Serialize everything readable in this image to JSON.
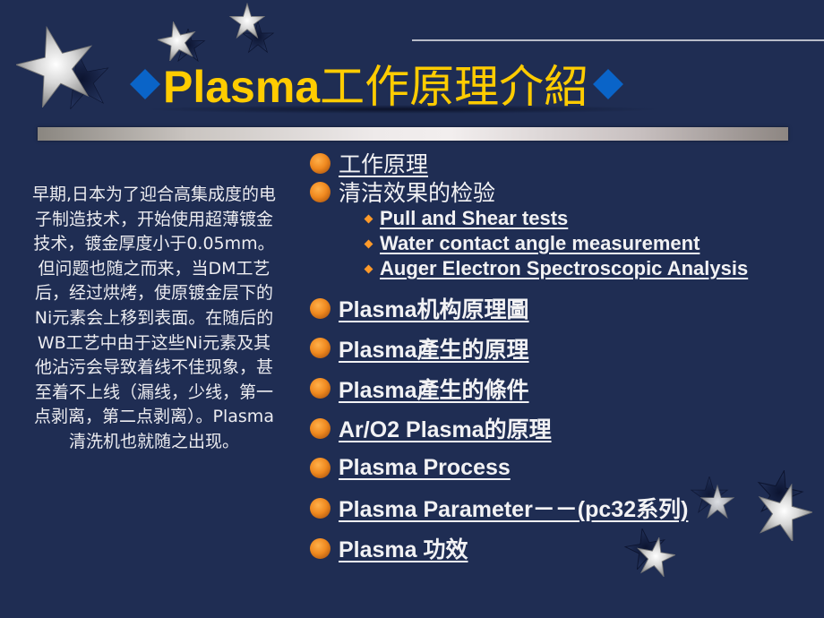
{
  "slide": {
    "title": {
      "latin": "Plasma",
      "cjk": "工作原理介紹",
      "left_icon": "blue-diamond-icon",
      "right_icon": "blue-diamond-icon",
      "color": "#ffcc00"
    },
    "intro_text": "早期,日本为了迎合高集成度的电子制造技术，开始使用超薄镀金技术，镀金厚度小于0.05mm。但问题也随之而来，当DM工艺后，经过烘烤，使原镀金层下的Ni元素会上移到表面。在随后的WB工艺中由于这些Ni元素及其他沾污会导致着线不佳现象，甚至着不上线（漏线，少线，第一点剥离，第二点剥离）。Plasma清洗机也就随之出现。",
    "menu": {
      "items": [
        {
          "label": "工作原理",
          "icon": "orange-ball-bullet-icon",
          "link": true
        },
        {
          "label": "清洁效果的检验",
          "icon": "orange-ball-bullet-icon",
          "link": false,
          "subitems": [
            {
              "label": "Pull and Shear tests",
              "icon": "orange-diamond-bullet-icon"
            },
            {
              "label": "Water contact angle measurement",
              "icon": "orange-diamond-bullet-icon"
            },
            {
              "label": "Auger Electron Spectroscopic Analysis",
              "icon": "orange-diamond-bullet-icon"
            }
          ]
        },
        {
          "label": "Plasma机构原理圖",
          "icon": "orange-ball-bullet-icon",
          "link": true
        },
        {
          "label": "Plasma產生的原理",
          "icon": "orange-ball-bullet-icon",
          "link": true
        },
        {
          "label": "Plasma產生的條件",
          "icon": "orange-ball-bullet-icon",
          "link": true
        },
        {
          "label": "Ar/O2 Plasma的原理",
          "icon": "orange-ball-bullet-icon",
          "link": true
        },
        {
          "label": "Plasma Process",
          "icon": "orange-ball-bullet-icon",
          "link": true
        },
        {
          "label": "Plasma Parameter－－(pc32系列)",
          "icon": "orange-ball-bullet-icon",
          "link": true
        },
        {
          "label": "Plasma 功效",
          "icon": "orange-ball-bullet-icon",
          "link": true
        }
      ]
    },
    "colors": {
      "background": "#1f2d53",
      "accent_diamond": "#0a64c8",
      "bullet": "#f08a20",
      "text": "#f2f2f4"
    },
    "decorations": [
      "silver-star-icon",
      "silver-star-icon",
      "silver-star-icon",
      "silver-star-icon",
      "silver-star-icon",
      "silver-star-icon"
    ]
  }
}
